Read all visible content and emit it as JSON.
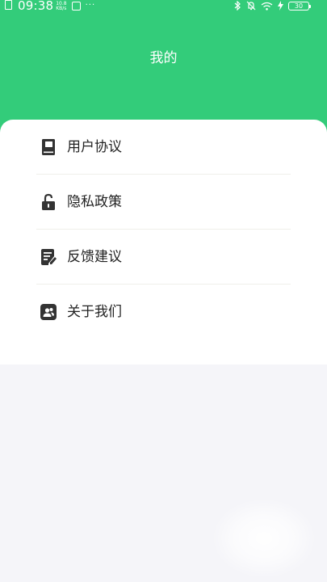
{
  "status_bar": {
    "time": "09:38",
    "net_speed_value": "10.8",
    "net_speed_unit": "KB/s",
    "more": "···",
    "battery": "30"
  },
  "header": {
    "title": "我的"
  },
  "menu": {
    "items": [
      {
        "label": "用户协议",
        "icon": "book-icon"
      },
      {
        "label": "隐私政策",
        "icon": "unlock-icon"
      },
      {
        "label": "反馈建议",
        "icon": "edit-note-icon"
      },
      {
        "label": "关于我们",
        "icon": "people-icon"
      }
    ]
  },
  "colors": {
    "accent": "#33cc7a",
    "card": "#ffffff",
    "background": "#f5f5f9",
    "icon": "#333333",
    "text": "#222222"
  }
}
